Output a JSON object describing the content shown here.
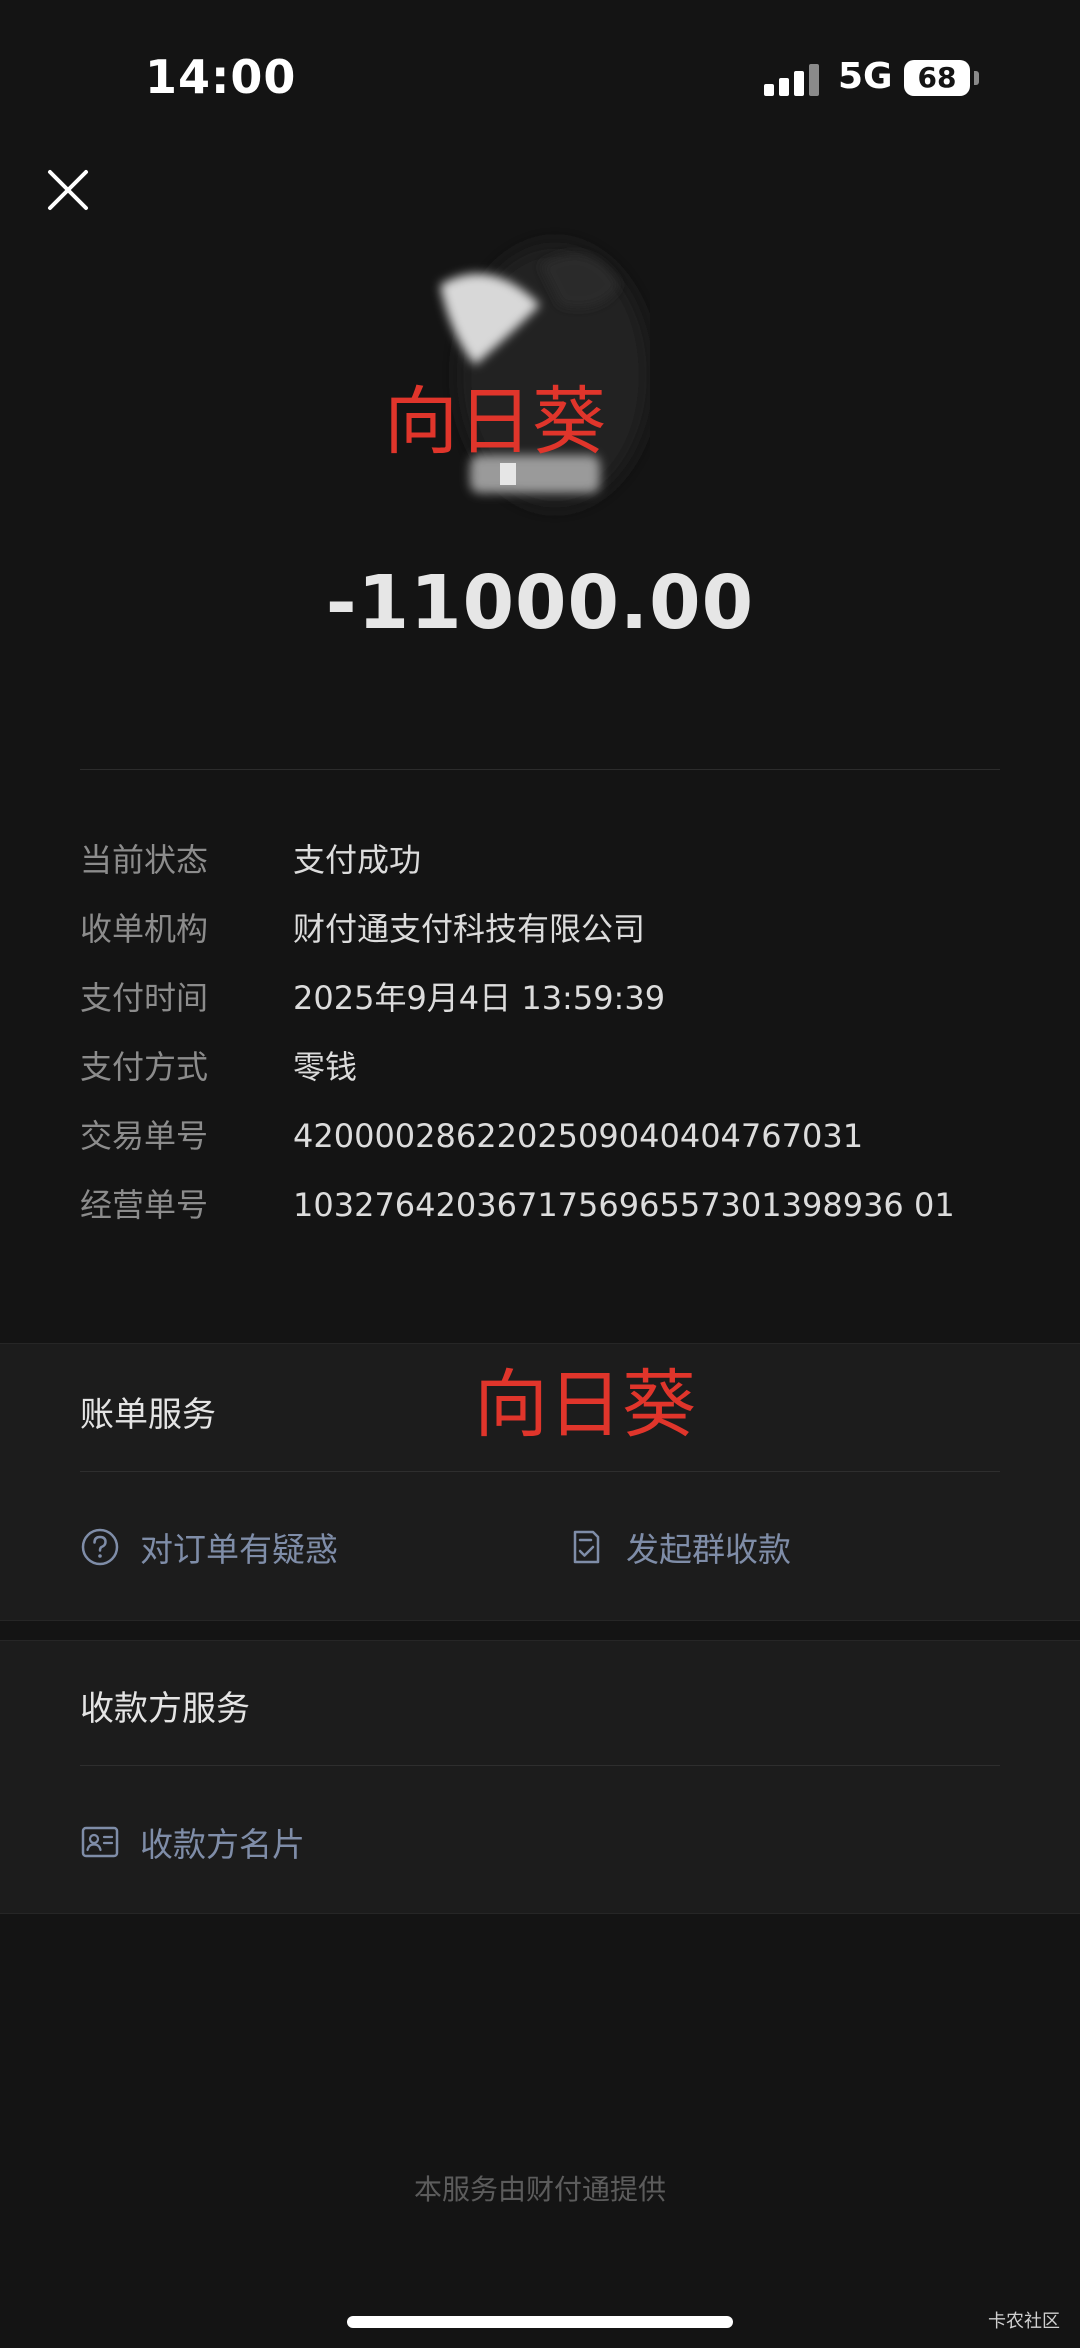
{
  "status_bar": {
    "time": "14:00",
    "network": "5G",
    "battery": "68"
  },
  "header": {
    "close_icon": "close-icon"
  },
  "merchant": {
    "watermark": "向日葵",
    "amount": "-11000.00"
  },
  "details": [
    {
      "label": "当前状态",
      "value": "支付成功"
    },
    {
      "label": "收单机构",
      "value": "财付通支付科技有限公司"
    },
    {
      "label": "支付时间",
      "value": "2025年9月4日 13:59:39"
    },
    {
      "label": "支付方式",
      "value": "零钱"
    },
    {
      "label": "交易单号",
      "value": "4200002862202509040404767031"
    },
    {
      "label": "经营单号",
      "value": "103276420367175696557301398936 01"
    }
  ],
  "bill_service": {
    "title": "账单服务",
    "watermark": "向日葵",
    "actions": [
      {
        "label": "对订单有疑惑",
        "icon": "question-circle-icon"
      },
      {
        "label": "发起群收款",
        "icon": "checklist-icon"
      }
    ]
  },
  "payee_service": {
    "title": "收款方服务",
    "actions": [
      {
        "label": "收款方名片",
        "icon": "contact-card-icon"
      }
    ]
  },
  "footer": {
    "text": "本服务由财付通提供",
    "corner_mark": "卡农社区"
  },
  "colors": {
    "background": "#141414",
    "card": "#1c1c1c",
    "link": "#7f8da8",
    "watermark": "#e0352b"
  }
}
